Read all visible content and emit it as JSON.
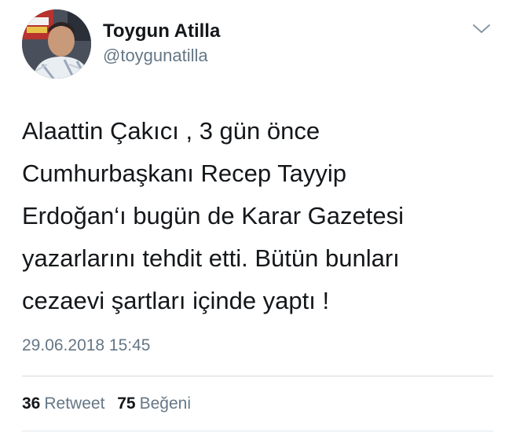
{
  "user": {
    "display_name": "Toygun Atilla",
    "handle": "@toygunatilla",
    "avatar_icon": "user-avatar-photo"
  },
  "menu": {
    "icon": "chevron-down-icon"
  },
  "tweet": {
    "text": "Alaattin Çakıcı , 3 gün önce\nCumhurbaşkanı Recep Tayyip\nErdoğan‘ı bugün de Karar Gazetesi\nyazarlarını tehdit etti. Bütün bunları\ncezaevi şartları içinde yaptı !",
    "timestamp": "29.06.2018 15:45"
  },
  "stats": {
    "retweets_count": "36",
    "retweets_label": "Retweet",
    "likes_count": "75",
    "likes_label": "Beğeni"
  },
  "colors": {
    "text": "#14171a",
    "muted": "#657786",
    "divider": "#d5dbe0"
  }
}
